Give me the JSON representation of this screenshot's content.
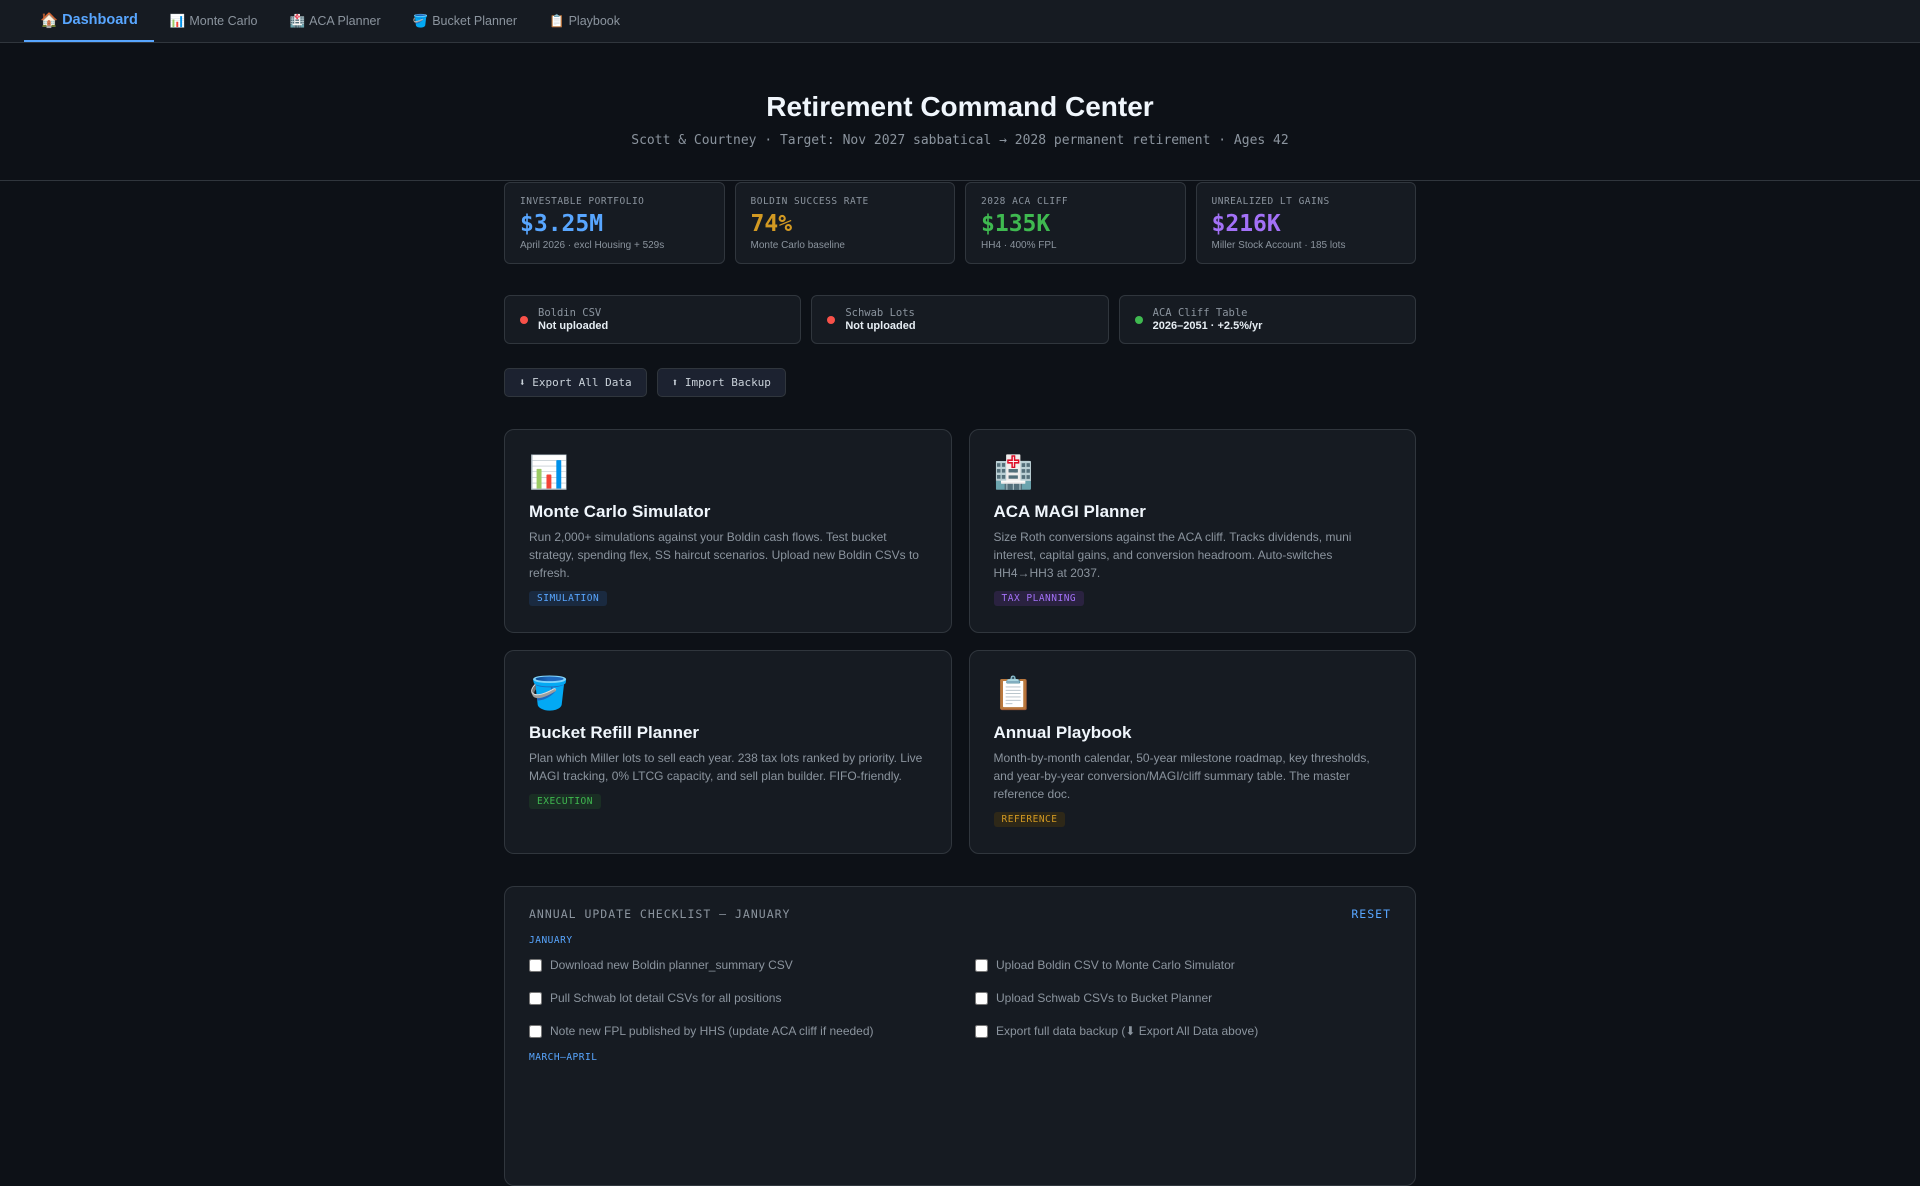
{
  "nav": {
    "tabs": [
      {
        "icon": "🏠",
        "label": "Dashboard"
      },
      {
        "icon": "📊",
        "label": "Monte Carlo"
      },
      {
        "icon": "🏥",
        "label": "ACA Planner"
      },
      {
        "icon": "🪣",
        "label": "Bucket Planner"
      },
      {
        "icon": "📋",
        "label": "Playbook"
      }
    ]
  },
  "header": {
    "title": "Retirement Command Center",
    "subtitle": "Scott & Courtney · Target: Nov 2027 sabbatical → 2028 permanent retirement · Ages 42"
  },
  "stats": [
    {
      "label": "INVESTABLE PORTFOLIO",
      "value": "$3.25M",
      "note": "April 2026 · excl Housing + 529s",
      "color": "#58a6ff"
    },
    {
      "label": "BOLDIN SUCCESS RATE",
      "value": "74%",
      "note": "Monte Carlo baseline",
      "color": "#d29922"
    },
    {
      "label": "2028 ACA CLIFF",
      "value": "$135K",
      "note": "HH4 · 400% FPL",
      "color": "#3fb950"
    },
    {
      "label": "UNREALIZED LT GAINS",
      "value": "$216K",
      "note": "Miller Stock Account · 185 lots",
      "color": "#a371f7"
    }
  ],
  "status": [
    {
      "label": "Boldin CSV",
      "value": "Not uploaded",
      "color": "#f85149"
    },
    {
      "label": "Schwab Lots",
      "value": "Not uploaded",
      "color": "#f85149"
    },
    {
      "label": "ACA Cliff Table",
      "value": "2026–2051 · +2.5%/yr",
      "color": "#3fb950"
    }
  ],
  "buttons": {
    "export": "⬇ Export All Data",
    "import": "⬆ Import Backup"
  },
  "tools": [
    {
      "icon": "📊",
      "title": "Monte Carlo Simulator",
      "desc": "Run 2,000+ simulations against your Boldin cash flows. Test bucket strategy, spending flex, SS haircut scenarios. Upload new Boldin CSVs to refresh.",
      "tag": "SIMULATION",
      "tag_color": "#58a6ff",
      "tag_bg": "#1a2a40"
    },
    {
      "icon": "🏥",
      "title": "ACA MAGI Planner",
      "desc": "Size Roth conversions against the ACA cliff. Tracks dividends, muni interest, capital gains, and conversion headroom. Auto-switches HH4→HH3 at 2037.",
      "tag": "TAX PLANNING",
      "tag_color": "#a371f7",
      "tag_bg": "#2a2240"
    },
    {
      "icon": "🪣",
      "title": "Bucket Refill Planner",
      "desc": "Plan which Miller lots to sell each year. 238 tax lots ranked by priority. Live MAGI tracking, 0% LTCG capacity, and sell plan builder. FIFO-friendly.",
      "tag": "EXECUTION",
      "tag_color": "#3fb950",
      "tag_bg": "#1a2e24"
    },
    {
      "icon": "📋",
      "title": "Annual Playbook",
      "desc": "Month-by-month calendar, 50-year milestone roadmap, key thresholds, and year-by-year conversion/MAGI/cliff summary table. The master reference doc.",
      "tag": "REFERENCE",
      "tag_color": "#d29922",
      "tag_bg": "#2e2818"
    }
  ],
  "checklist": {
    "title": "ANNUAL UPDATE CHECKLIST — JANUARY",
    "reset": "RESET",
    "sections": [
      {
        "name": "JANUARY",
        "items": [
          "Download new Boldin planner_summary CSV",
          "Upload Boldin CSV to Monte Carlo Simulator",
          "Pull Schwab lot detail CSVs for all positions",
          "Upload Schwab CSVs to Bucket Planner",
          "Note new FPL published by HHS (update ACA cliff if needed)",
          "Export full data backup (⬇ Export All Data above)"
        ]
      },
      {
        "name": "MARCH–APRIL",
        "items": []
      }
    ]
  }
}
